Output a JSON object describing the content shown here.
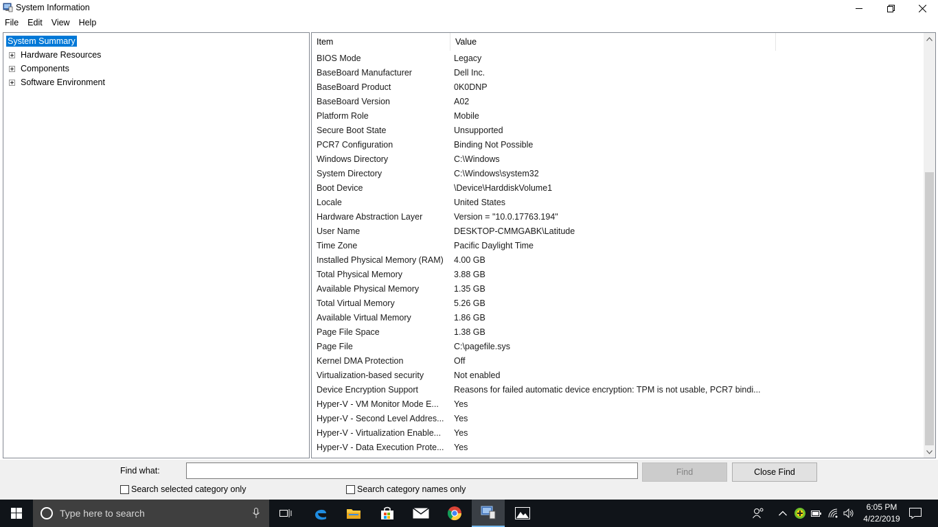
{
  "window": {
    "title": "System Information",
    "minimize_glyph": "—",
    "maximize_glyph": "❐",
    "close_glyph": "✕"
  },
  "menu": [
    {
      "label": "File"
    },
    {
      "label": "Edit"
    },
    {
      "label": "View"
    },
    {
      "label": "Help"
    }
  ],
  "tree": {
    "selected": "System Summary",
    "items": [
      {
        "label": "Hardware Resources"
      },
      {
        "label": "Components"
      },
      {
        "label": "Software Environment"
      }
    ]
  },
  "list": {
    "columns": {
      "item": "Item",
      "value": "Value"
    },
    "rows": [
      {
        "item": "BIOS Mode",
        "value": "Legacy"
      },
      {
        "item": "BaseBoard Manufacturer",
        "value": "Dell Inc."
      },
      {
        "item": "BaseBoard Product",
        "value": "0K0DNP"
      },
      {
        "item": "BaseBoard Version",
        "value": "A02"
      },
      {
        "item": "Platform Role",
        "value": "Mobile"
      },
      {
        "item": "Secure Boot State",
        "value": "Unsupported"
      },
      {
        "item": "PCR7 Configuration",
        "value": "Binding Not Possible"
      },
      {
        "item": "Windows Directory",
        "value": "C:\\Windows"
      },
      {
        "item": "System Directory",
        "value": "C:\\Windows\\system32"
      },
      {
        "item": "Boot Device",
        "value": "\\Device\\HarddiskVolume1"
      },
      {
        "item": "Locale",
        "value": "United States"
      },
      {
        "item": "Hardware Abstraction Layer",
        "value": "Version = \"10.0.17763.194\""
      },
      {
        "item": "User Name",
        "value": "DESKTOP-CMMGABK\\Latitude"
      },
      {
        "item": "Time Zone",
        "value": "Pacific Daylight Time"
      },
      {
        "item": "Installed Physical Memory (RAM)",
        "value": "4.00 GB"
      },
      {
        "item": "Total Physical Memory",
        "value": "3.88 GB"
      },
      {
        "item": "Available Physical Memory",
        "value": "1.35 GB"
      },
      {
        "item": "Total Virtual Memory",
        "value": "5.26 GB"
      },
      {
        "item": "Available Virtual Memory",
        "value": "1.86 GB"
      },
      {
        "item": "Page File Space",
        "value": "1.38 GB"
      },
      {
        "item": "Page File",
        "value": "C:\\pagefile.sys"
      },
      {
        "item": "Kernel DMA Protection",
        "value": "Off"
      },
      {
        "item": "Virtualization-based security",
        "value": "Not enabled"
      },
      {
        "item": "Device Encryption Support",
        "value": "Reasons for failed automatic device encryption: TPM is not usable, PCR7 bindi..."
      },
      {
        "item": "Hyper-V - VM Monitor Mode E...",
        "value": "Yes"
      },
      {
        "item": "Hyper-V - Second Level Addres...",
        "value": "Yes"
      },
      {
        "item": "Hyper-V - Virtualization Enable...",
        "value": "Yes"
      },
      {
        "item": "Hyper-V - Data Execution Prote...",
        "value": "Yes"
      }
    ]
  },
  "find": {
    "label": "Find what:",
    "value": "",
    "find_button": "Find",
    "close_button": "Close Find",
    "check_selected": "Search selected category only",
    "check_names": "Search category names only"
  },
  "taskbar": {
    "search_placeholder": "Type here to search",
    "time": "6:05 PM",
    "date": "4/22/2019",
    "accent": "#76b9ed"
  }
}
